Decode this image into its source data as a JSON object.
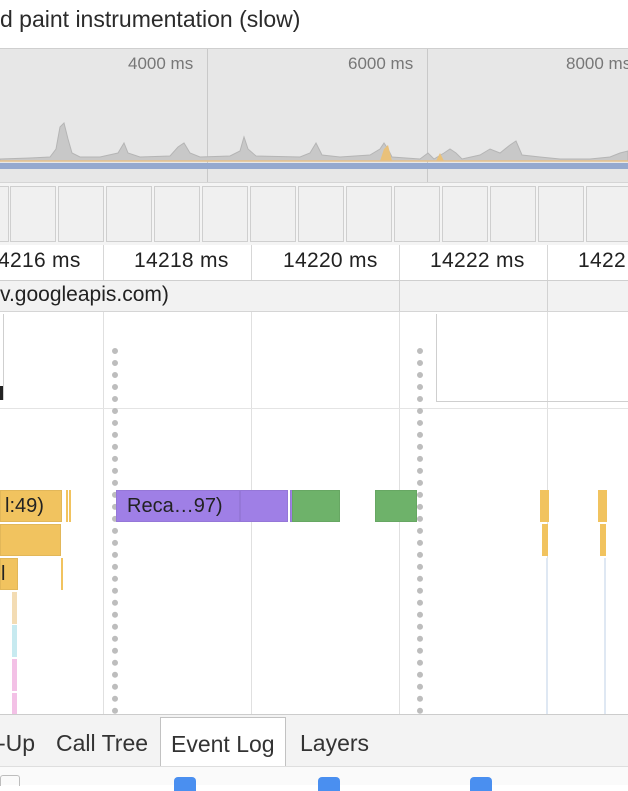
{
  "header": {
    "checkbox_label": "d paint instrumentation (slow)"
  },
  "overview": {
    "ticks": [
      "4000 ms",
      "6000 ms",
      "8000 ms"
    ]
  },
  "ruler": {
    "ticks": [
      "4216 ms",
      "14218 ms",
      "14220 ms",
      "14222 ms",
      "1422"
    ]
  },
  "network": {
    "label": "v.googleapis.com)"
  },
  "flame": {
    "bar_labels": [
      "l:49)",
      "Reca…97)",
      "l"
    ]
  },
  "tabs": [
    {
      "label": "-Up",
      "active": false
    },
    {
      "label": "Call Tree",
      "active": false
    },
    {
      "label": "Event Log",
      "active": true
    },
    {
      "label": "Layers",
      "active": false
    }
  ],
  "colors": {
    "scripting": "#f1c35f",
    "rendering": "#9f7fe6",
    "painting": "#6eb26a",
    "checkbox": "#4a8ff0"
  }
}
